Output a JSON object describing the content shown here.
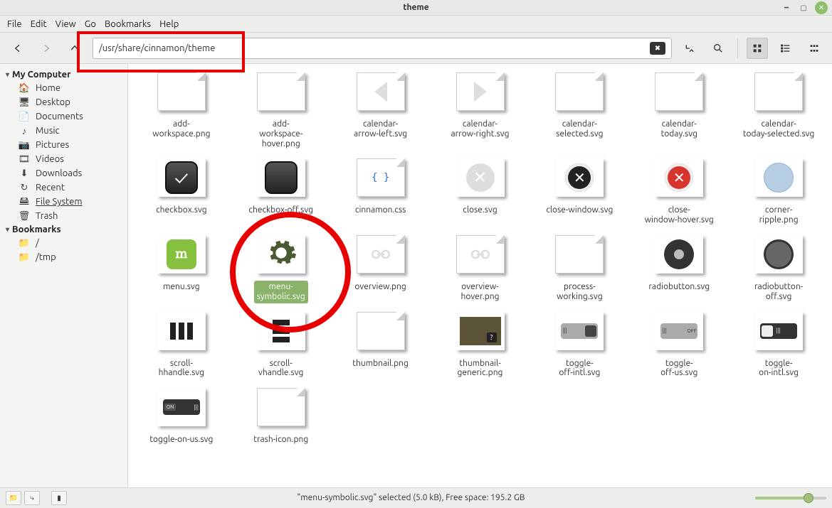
{
  "window": {
    "title": "theme"
  },
  "menubar": {
    "items": [
      "File",
      "Edit",
      "View",
      "Go",
      "Bookmarks",
      "Help"
    ]
  },
  "toolbar": {
    "path": "/usr/share/cinnamon/theme"
  },
  "sidebar": {
    "sections": [
      {
        "title": "My Computer",
        "items": [
          {
            "icon": "home",
            "label": "Home"
          },
          {
            "icon": "desktop",
            "label": "Desktop"
          },
          {
            "icon": "documents",
            "label": "Documents"
          },
          {
            "icon": "music",
            "label": "Music"
          },
          {
            "icon": "pictures",
            "label": "Pictures"
          },
          {
            "icon": "videos",
            "label": "Videos"
          },
          {
            "icon": "downloads",
            "label": "Downloads"
          },
          {
            "icon": "recent",
            "label": "Recent"
          },
          {
            "icon": "filesystem",
            "label": "File System",
            "selected": true
          },
          {
            "icon": "trash",
            "label": "Trash"
          }
        ]
      },
      {
        "title": "Bookmarks",
        "items": [
          {
            "icon": "folder",
            "label": "/"
          },
          {
            "icon": "folder",
            "label": "/tmp"
          }
        ]
      }
    ]
  },
  "files": [
    {
      "name": "add-workspace.png",
      "kind": "img-blank"
    },
    {
      "name": "add-workspace-hover.png",
      "kind": "img-blank"
    },
    {
      "name": "calendar-arrow-left.svg",
      "kind": "arrow-left"
    },
    {
      "name": "calendar-arrow-right.svg",
      "kind": "arrow-right"
    },
    {
      "name": "calendar-selected.svg",
      "kind": "img-blank"
    },
    {
      "name": "calendar-today.svg",
      "kind": "img-blank"
    },
    {
      "name": "calendar-today-selected.svg",
      "kind": "img-blank"
    },
    {
      "name": "checkbox.svg",
      "kind": "checkbox"
    },
    {
      "name": "checkbox-off.svg",
      "kind": "checkbox-off"
    },
    {
      "name": "cinnamon.css",
      "kind": "css"
    },
    {
      "name": "close.svg",
      "kind": "close-grey"
    },
    {
      "name": "close-window.svg",
      "kind": "close-dark"
    },
    {
      "name": "close-window-hover.svg",
      "kind": "close-red"
    },
    {
      "name": "corner-ripple.png",
      "kind": "ripple"
    },
    {
      "name": "menu.svg",
      "kind": "logo"
    },
    {
      "name": "menu-symbolic.svg",
      "kind": "gear",
      "selected": true
    },
    {
      "name": "overview.png",
      "kind": "link"
    },
    {
      "name": "overview-hover.png",
      "kind": "link"
    },
    {
      "name": "process-working.svg",
      "kind": "img-blank"
    },
    {
      "name": "radiobutton.svg",
      "kind": "radio-on"
    },
    {
      "name": "radiobutton-off.svg",
      "kind": "radio-off"
    },
    {
      "name": "scroll-hhandle.svg",
      "kind": "hhandle"
    },
    {
      "name": "scroll-vhandle.svg",
      "kind": "vhandle"
    },
    {
      "name": "thumbnail.png",
      "kind": "img-blank"
    },
    {
      "name": "thumbnail-generic.png",
      "kind": "thumb-generic"
    },
    {
      "name": "toggle-off-intl.svg",
      "kind": "toggle-off"
    },
    {
      "name": "toggle-off-us.svg",
      "kind": "toggle-off-us"
    },
    {
      "name": "toggle-on-intl.svg",
      "kind": "toggle-on"
    },
    {
      "name": "toggle-on-us.svg",
      "kind": "toggle-on-us"
    },
    {
      "name": "trash-icon.png",
      "kind": "img-blank"
    }
  ],
  "status": {
    "message": "\"menu-symbolic.svg\" selected (5.0 kB), Free space: 195.2 GB"
  }
}
